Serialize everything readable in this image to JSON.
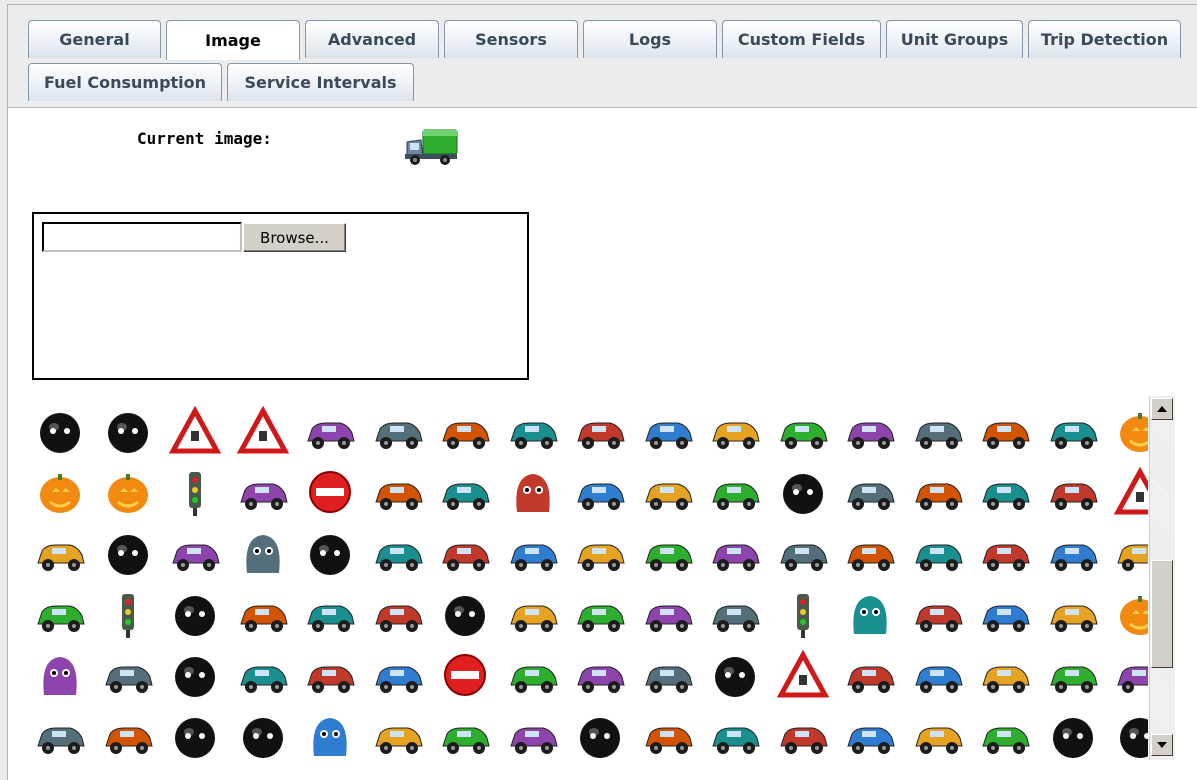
{
  "tabs": [
    {
      "label": "General",
      "active": false
    },
    {
      "label": "Image",
      "active": true
    },
    {
      "label": "Advanced",
      "active": false
    },
    {
      "label": "Sensors",
      "active": false
    },
    {
      "label": "Logs",
      "active": false
    },
    {
      "label": "Custom Fields",
      "active": false
    },
    {
      "label": "Unit Groups",
      "active": false
    },
    {
      "label": "Trip Detection",
      "active": false
    },
    {
      "label": "Fuel Consumption",
      "active": false
    },
    {
      "label": "Service Intervals",
      "active": false
    }
  ],
  "current_image": {
    "label": "Current image:",
    "icon": "green-truck-icon"
  },
  "upload": {
    "file_value": "",
    "browse_label": "Browse..."
  },
  "gallery": {
    "rows": [
      [
        "bomb-icon",
        "monster-face-icon",
        "warning-sign-icon",
        "warning-sign-icon",
        "rubber-duck-boat-icon",
        "hot-air-balloon-icon",
        "scooter-icon",
        "boat-icon",
        "cars-icon",
        "policeman-icon",
        "motorcyclist-icon",
        "sports-car-icon",
        "tank-icon",
        "sedan-icon",
        "ship-icon",
        "train-icon",
        "pumpkin-icon"
      ],
      [
        "pumpkin-icon",
        "lantern-pumpkin-icon",
        "traffic-light-icon",
        "route-help-icon",
        "no-entry-icon",
        "dirt-bike-icon",
        "speedboat-icon",
        "ghost-icon",
        "airplane-icon",
        "jeep-icon",
        "rocket-icon",
        "tire-icon",
        "british-policeman-icon",
        "forklift-icon",
        "helicopter-icon",
        "dragster-icon",
        "pedestrian-warning-icon"
      ],
      [
        "helicopter-icon",
        "tire-icon",
        "pen-icon",
        "cookie-monster-icon",
        "black-ball-icon",
        "green-truck-icon",
        "cash-register-icon",
        "double-decker-bus-icon",
        "pickup-truck-icon",
        "steering-icon",
        "shop-icon",
        "driver-icon",
        "boat-icon",
        "uk-flag-car-icon",
        "atv-icon",
        "jet-icon",
        "germany-flag-car-icon"
      ],
      [
        "screwdriver-icon",
        "parking-meter-icon",
        "wheelchair-sign-icon",
        "baby-buggy-icon",
        "motorcycle-icon",
        "black-truck-icon",
        "bomb-icon",
        "sailing-ship-icon",
        "fire-truck-icon",
        "tow-truck-icon",
        "hand-truck-icon",
        "traffic-light-icon",
        "pink-ghost-icon",
        "barrier-icon",
        "cable-car-icon",
        "mechanic-icon",
        "pumpkin-icon"
      ],
      [
        "red-monster-icon",
        "dump-truck-icon",
        "tire-icon",
        "road-icon",
        "school-bus-icon",
        "rv-icon",
        "no-parking-icon",
        "tram-icon",
        "railroad-crossing-icon",
        "van-icon",
        "black-monster-icon",
        "traffic-warning-icon",
        "horse-carriage-icon",
        "blue-car-icon",
        "camper-icon",
        "one-way-sign-icon",
        "satellite-icon"
      ],
      [
        "motorbike-icon",
        "space-shuttle-icon",
        "steering-wheel-icon",
        "wheelchair-icon",
        "yellow-monster-icon",
        "railway-track-icon",
        "tanker-truck-icon",
        "bulldozer-icon",
        "speedometer-icon",
        "locomotive-icon",
        "barrier-gate-icon",
        "firetruck-icon",
        "bus-icon",
        "wagon-icon",
        "gear-icon",
        "devil-icon",
        "screaming-face-icon"
      ]
    ]
  },
  "colors": {
    "accent": "#3a4a5a",
    "tab_border": "#8496a8"
  }
}
